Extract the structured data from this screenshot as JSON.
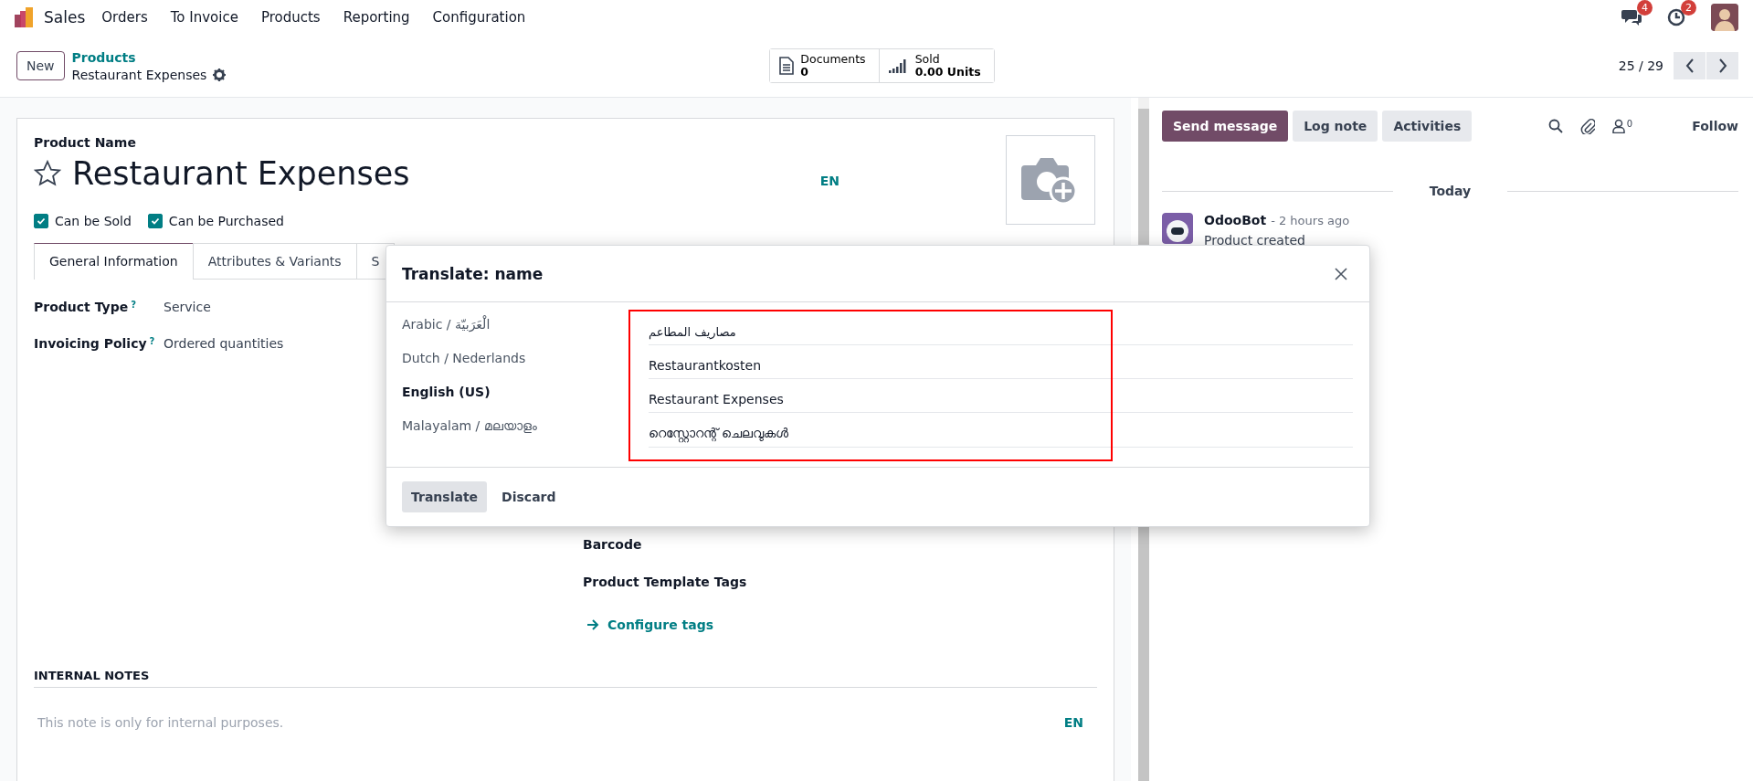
{
  "navbar": {
    "app": "Sales",
    "menu": [
      "Orders",
      "To Invoice",
      "Products",
      "Reporting",
      "Configuration"
    ],
    "messages_badge": "4",
    "activities_badge": "2"
  },
  "control_panel": {
    "new_button": "New",
    "breadcrumb": "Products",
    "record": "Restaurant Expenses",
    "stats": [
      {
        "kind": "documents",
        "label": "Documents",
        "value": "0"
      },
      {
        "kind": "sold",
        "label": "Sold",
        "value": "0.00 Units"
      }
    ],
    "pager": "25 / 29"
  },
  "form": {
    "name_label": "Product Name",
    "name": "Restaurant Expenses",
    "favorite": false,
    "lang": "EN",
    "checkboxes": [
      {
        "label": "Can be Sold",
        "checked": true
      },
      {
        "label": "Can be Purchased",
        "checked": true
      }
    ],
    "tabs": [
      {
        "label": "General Information",
        "selected": true
      },
      {
        "label": "Attributes & Variants",
        "selected": false
      },
      {
        "label": "S",
        "selected": false
      }
    ],
    "fields": [
      {
        "label": "Product Type",
        "help": "?",
        "value": "Service"
      },
      {
        "label": "Invoicing Policy",
        "help": "?",
        "value": "Ordered quantities"
      }
    ],
    "right_fields": [
      {
        "kind": "label",
        "text": "Barcode"
      },
      {
        "kind": "label",
        "text": "Product Template Tags"
      },
      {
        "kind": "link",
        "text": "Configure tags"
      }
    ],
    "notes": {
      "title": "INTERNAL NOTES",
      "placeholder": "This note is only for internal purposes.",
      "lang": "EN"
    }
  },
  "chatter": {
    "buttons": [
      {
        "label": "Send message",
        "selected": true
      },
      {
        "label": "Log note",
        "selected": false
      },
      {
        "label": "Activities",
        "selected": false
      }
    ],
    "followers": "0",
    "follow": "Follow",
    "date": "Today",
    "messages": [
      {
        "author": "OdooBot",
        "time": "- 2 hours ago",
        "body": "Product created"
      }
    ]
  },
  "dialog": {
    "title": "Translate: name",
    "highlighted": true,
    "rows": [
      {
        "language": "Arabic / الْعَرَبيّة",
        "value": "مصاريف المطاعم",
        "current": false,
        "rtl": true
      },
      {
        "language": "Dutch / Nederlands",
        "value": "Restaurantkosten",
        "current": false,
        "rtl": false
      },
      {
        "language": "English (US)",
        "value": "Restaurant Expenses",
        "current": true,
        "rtl": false
      },
      {
        "language": "Malayalam / മലയാളം",
        "value": "റെസ്റ്റോറന്റ് ചെലവുകൾ",
        "current": false,
        "rtl": false
      }
    ],
    "buttons": [
      {
        "label": "Translate",
        "primary": true
      },
      {
        "label": "Discard",
        "primary": false
      }
    ]
  }
}
